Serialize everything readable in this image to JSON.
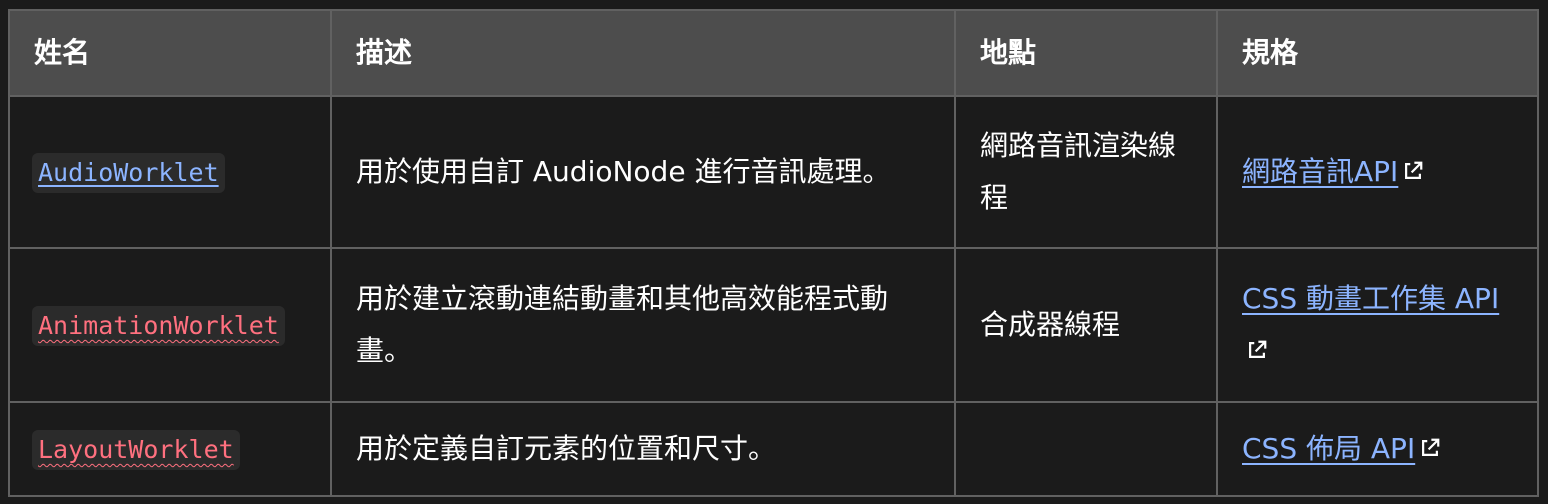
{
  "table": {
    "headers": [
      "姓名",
      "描述",
      "地點",
      "規格"
    ],
    "rows": [
      {
        "name": "AudioWorklet",
        "description": "用於使用自訂 AudioNode 進行音訊處理。",
        "location": "網路音訊渲染線程",
        "spec": "網路音訊API"
      },
      {
        "name": "AnimationWorklet",
        "description": "用於建立滾動連結動畫和其他高效能程式動畫。",
        "location": "合成器線程",
        "spec": "CSS 動畫工作集 API"
      },
      {
        "name": "LayoutWorklet",
        "description": "用於定義自訂元素的位置和尺寸。",
        "location": "",
        "spec": "CSS 佈局 API"
      }
    ]
  },
  "icons": {
    "external": "external-link-icon"
  },
  "colors": {
    "background": "#1b1b1b",
    "header_background": "#4d4d4d",
    "border": "#616161",
    "link": "#8cb4ff",
    "broken_link": "#ff707f"
  }
}
